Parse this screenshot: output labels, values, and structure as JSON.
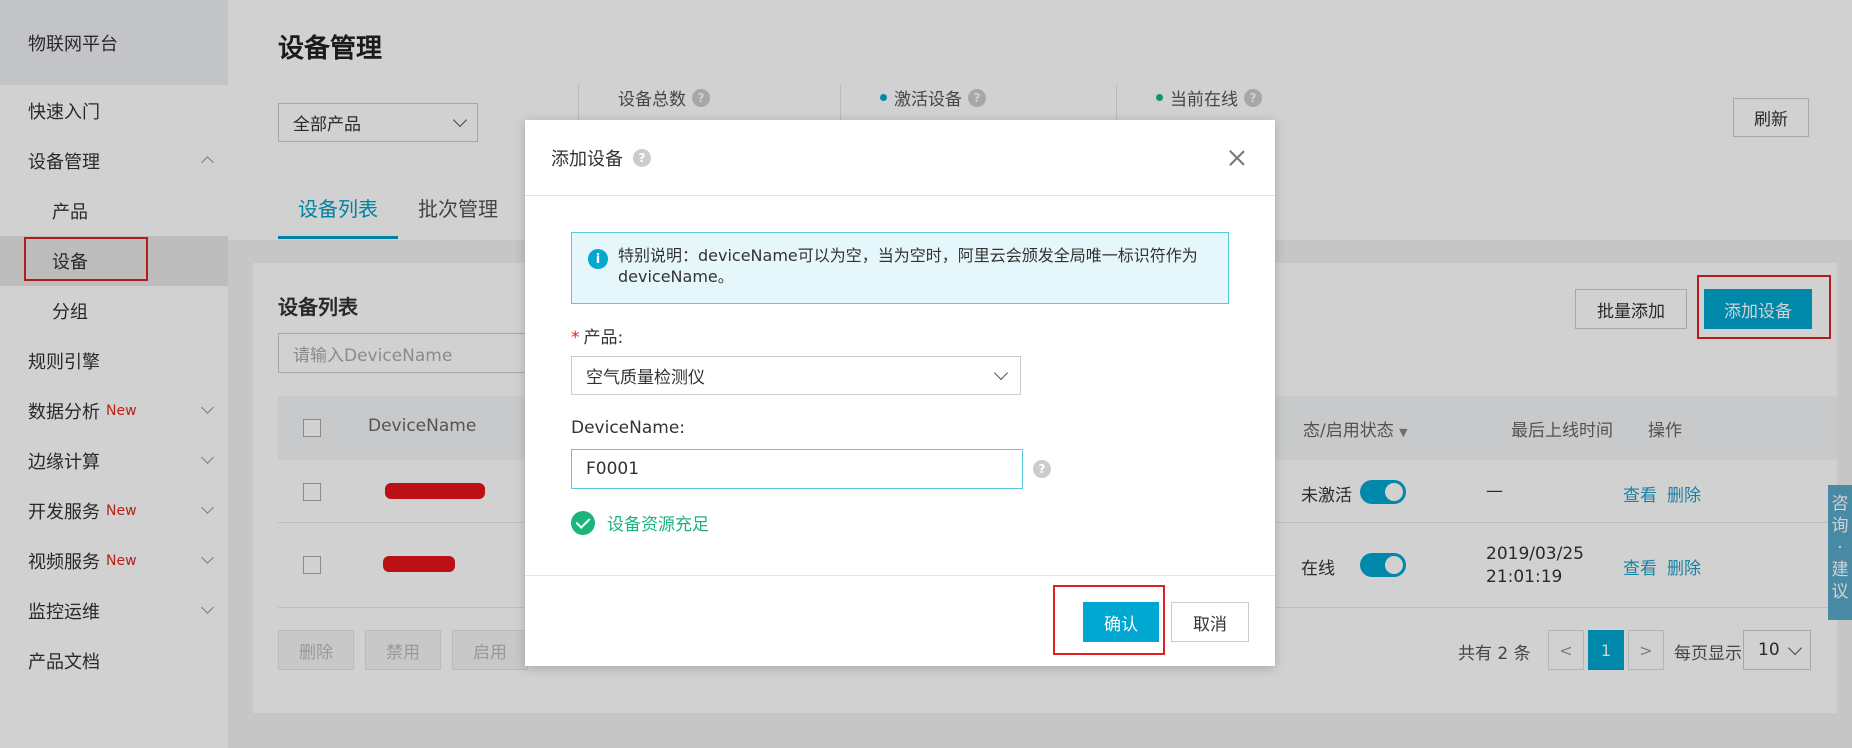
{
  "sidebar": {
    "header": "物联网平台",
    "items": [
      {
        "label": "快速入门",
        "new": ""
      },
      {
        "label": "设备管理",
        "new": ""
      },
      {
        "label": "产品",
        "new": ""
      },
      {
        "label": "设备",
        "new": ""
      },
      {
        "label": "分组",
        "new": ""
      },
      {
        "label": "规则引擎",
        "new": ""
      },
      {
        "label": "数据分析",
        "new": "New"
      },
      {
        "label": "边缘计算",
        "new": ""
      },
      {
        "label": "开发服务",
        "new": "New"
      },
      {
        "label": "视频服务",
        "new": "New"
      },
      {
        "label": "监控运维",
        "new": ""
      },
      {
        "label": "产品文档",
        "new": ""
      }
    ]
  },
  "header": {
    "title": "设备管理",
    "product_select": "全部产品",
    "stats": {
      "total": "设备总数",
      "activated": "激活设备",
      "online": "当前在线"
    },
    "refresh": "刷新",
    "tabs": [
      "设备列表",
      "批次管理"
    ]
  },
  "list": {
    "title": "设备列表",
    "search_placeholder": "请输入DeviceName",
    "batch_add": "批量添加",
    "add_device": "添加设备",
    "columns": {
      "device_name": "DeviceName",
      "status": "态/启用状态",
      "last_online": "最后上线时间",
      "actions": "操作"
    },
    "rows": [
      {
        "status": "未激活",
        "last_online": "—",
        "last_online_time": "",
        "view": "查看",
        "delete": "删除"
      },
      {
        "status": "在线",
        "last_online": "2019/03/25",
        "last_online_time": "21:01:19",
        "view": "查看",
        "delete": "删除"
      }
    ],
    "bulk_buttons": [
      "删除",
      "禁用",
      "启用"
    ],
    "pager": {
      "total": "共有 2 条",
      "current": "1",
      "prev": "<",
      "next": ">",
      "per_page_label": "每页显示:",
      "per_page": "10"
    }
  },
  "float_tab": [
    "咨",
    "询",
    "·",
    "建",
    "议"
  ],
  "modal": {
    "title": "添加设备",
    "notice": "特别说明：deviceName可以为空，当为空时，阿里云会颁发全局唯一标识符作为deviceName。",
    "product_label": "产品:",
    "product_value": "空气质量检测仪",
    "devicename_label": "DeviceName:",
    "devicename_value": "F0001",
    "resource_ok": "设备资源充足",
    "confirm": "确认",
    "cancel": "取消"
  },
  "colors": {
    "accent": "#00a7d0",
    "success": "#1bb47a",
    "highlight_box": "#e02020",
    "new_badge": "#e0281e"
  }
}
